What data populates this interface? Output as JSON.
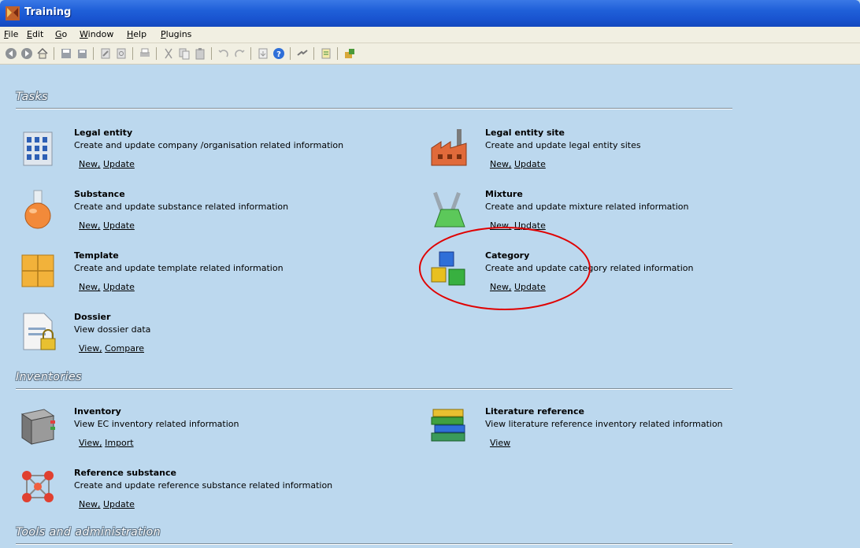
{
  "window": {
    "title": "Training",
    "accent": "#1f5fd8"
  },
  "menu": [
    "File",
    "Edit",
    "Go",
    "Window",
    "Help",
    "Plugins"
  ],
  "toolbar": {
    "icons": [
      "back-icon",
      "forward-icon",
      "home-icon",
      "save-icon",
      "save-all-icon",
      "edit-icon",
      "preview-icon",
      "print-icon",
      "cut-icon",
      "copy-icon",
      "paste-icon",
      "undo-icon",
      "redo-icon",
      "export-icon",
      "help-icon",
      "connection-icon",
      "report-icon",
      "plugin-icon"
    ]
  },
  "sections": {
    "tasks": {
      "title": "Tasks",
      "items": [
        {
          "name": "Legal entity",
          "desc": "Create and update company /organisation related information",
          "link1": "New,",
          "link2": "Update",
          "icon": "building-icon"
        },
        {
          "name": "Legal entity site",
          "desc": "Create and update legal entity sites",
          "link1": "New,",
          "link2": "Update",
          "icon": "factory-icon"
        },
        {
          "name": "Substance",
          "desc": "Create and update substance related information",
          "link1": "New,",
          "link2": "Update",
          "icon": "flask-icon"
        },
        {
          "name": "Mixture",
          "desc": "Create and update mixture related information",
          "link1": "New,",
          "link2": "Update",
          "icon": "mixture-icon"
        },
        {
          "name": "Template",
          "desc": "Create and update template related information",
          "link1": "New,",
          "link2": "Update",
          "icon": "boxes-icon"
        },
        {
          "name": "Category",
          "desc": "Create and update category related information",
          "link1": "New,",
          "link2": "Update",
          "icon": "cubes-icon"
        },
        {
          "name": "Dossier",
          "desc": "View dossier data",
          "link1": "View,",
          "link2": "Compare",
          "icon": "locked-document-icon"
        }
      ]
    },
    "inventories": {
      "title": "Inventories",
      "items": [
        {
          "name": "Inventory",
          "desc": "View EC inventory related information",
          "link1": "View,",
          "link2": "Import",
          "icon": "book-icon"
        },
        {
          "name": "Literature reference",
          "desc": "View literature reference inventory related information",
          "link1": "View",
          "link2": "",
          "icon": "books-stack-icon"
        },
        {
          "name": "Reference substance",
          "desc": "Create and update reference substance related information",
          "link1": "New,",
          "link2": "Update",
          "icon": "molecule-icon"
        }
      ]
    },
    "tools": {
      "title": "Tools and administration"
    }
  },
  "colors": {
    "background": "#bcd8ee",
    "highlight_ellipse": "#e00000"
  }
}
